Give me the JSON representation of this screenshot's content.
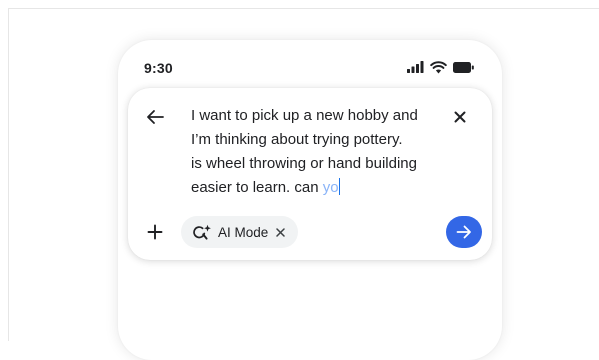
{
  "status_bar": {
    "time": "9:30",
    "icons": [
      "signal-icon",
      "wifi-icon",
      "battery-icon"
    ]
  },
  "search": {
    "query_lines": [
      "I want to pick up a new hobby and",
      "I’m thinking about trying pottery.",
      "is wheel throwing or hand building",
      "easier to learn. can "
    ],
    "suggestion": "yo",
    "back_icon": "arrow-left-icon",
    "clear_icon": "close-icon"
  },
  "toolbar": {
    "add_icon": "plus-icon",
    "chip": {
      "icon": "ai-search-sparkle-icon",
      "label": "AI Mode",
      "remove_icon": "close-icon"
    },
    "submit_icon": "arrow-right-icon"
  },
  "colors": {
    "accent": "#3367e6",
    "suggestion_text": "#8ab4f8",
    "chip_background": "#f1f3f4",
    "text": "#202124"
  }
}
